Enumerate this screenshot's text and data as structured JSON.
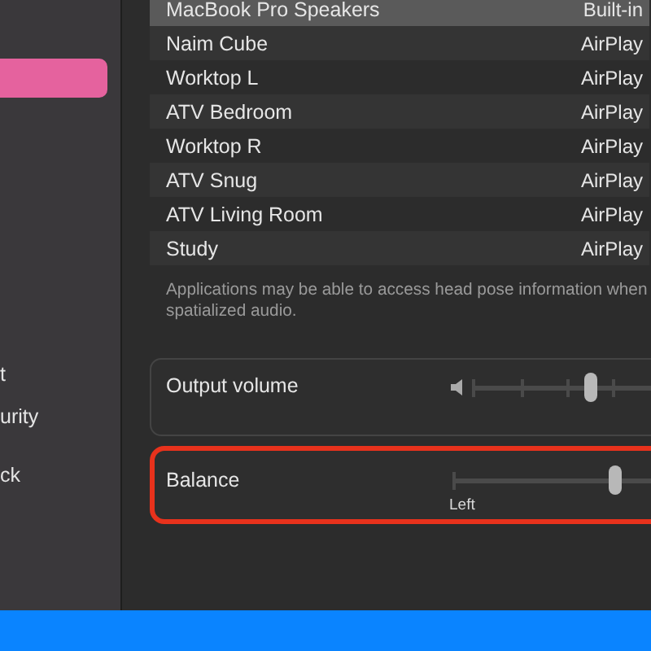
{
  "sidebar": {
    "items": [
      {
        "selected": true
      },
      {
        "label": "t",
        "selected": false
      },
      {
        "label": "urity",
        "selected": false
      },
      {
        "label": "ck",
        "selected": false
      }
    ]
  },
  "devices": [
    {
      "name": "MacBook Pro Speakers",
      "type": "Built-in",
      "selected": true
    },
    {
      "name": "Naim Cube",
      "type": "AirPlay",
      "selected": false
    },
    {
      "name": "Worktop L",
      "type": "AirPlay",
      "selected": false
    },
    {
      "name": "ATV Bedroom",
      "type": "AirPlay",
      "selected": false
    },
    {
      "name": "Worktop R",
      "type": "AirPlay",
      "selected": false
    },
    {
      "name": "ATV Snug",
      "type": "AirPlay",
      "selected": false
    },
    {
      "name": "ATV Living Room",
      "type": "AirPlay",
      "selected": false
    },
    {
      "name": "Study",
      "type": "AirPlay",
      "selected": false
    }
  ],
  "note": "Applications may be able to access head pose information when spatialized audio.",
  "controls": [
    {
      "kind": "volume",
      "label": "Output volume",
      "level": 0.58,
      "highlighted": false
    },
    {
      "kind": "balance",
      "label": "Balance",
      "level": 0.8,
      "min_label": "Left",
      "highlighted": true
    }
  ]
}
